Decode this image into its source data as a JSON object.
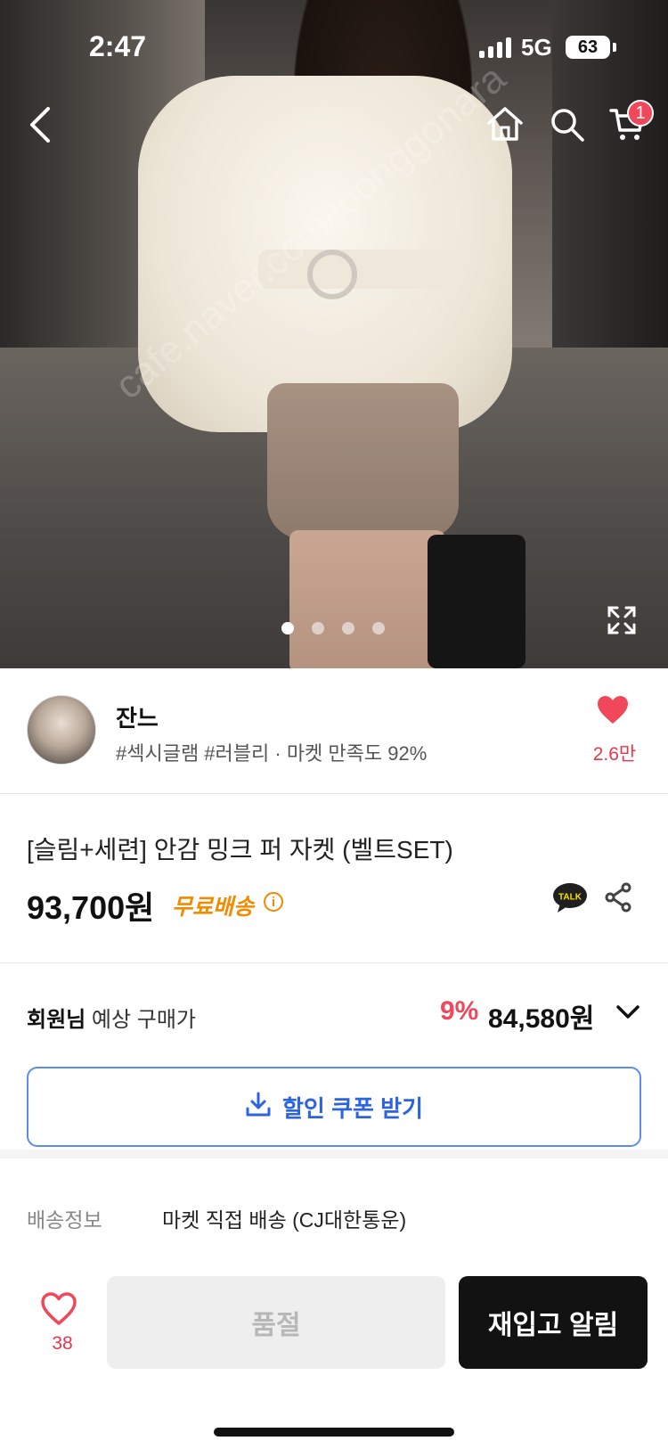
{
  "status_bar": {
    "time": "2:47",
    "network": "5G",
    "battery": "63"
  },
  "top_nav": {
    "cart_badge": "1"
  },
  "gallery": {
    "dots_total": 4,
    "active_index": 0,
    "watermark": "cafe.naver.com/joonggonara"
  },
  "seller": {
    "name": "잔느",
    "tags": "#섹시글램 #러블리 · 마켓 만족도 92%",
    "like_count": "2.6만"
  },
  "product": {
    "title": "[슬림+세련] 안감 밍크 퍼 자켓 (벨트SET)",
    "price": "93,700원",
    "shipping": "무료배송",
    "info_icon": "i",
    "talk_label": "TALK"
  },
  "member_price": {
    "label_bold": "회원님",
    "label_rest": " 예상 구매가",
    "discount": "9%",
    "price": "84,580원"
  },
  "coupon": {
    "label": "할인 쿠폰 받기"
  },
  "delivery": {
    "key": "배송정보",
    "value": "마켓 직접 배송 (CJ대한통운)"
  },
  "bottom_bar": {
    "wish_count": "38",
    "soldout_label": "품절",
    "restock_label": "재입고 알림"
  },
  "colors": {
    "accent_red": "#f0475a",
    "shipping_orange": "#f28b00",
    "coupon_blue": "#2b63e0"
  },
  "icons": [
    "back-icon",
    "home-icon",
    "search-icon",
    "cart-icon",
    "expand-icon",
    "heart-icon",
    "talk-icon",
    "share-icon",
    "chevron-down-icon",
    "download-icon"
  ]
}
